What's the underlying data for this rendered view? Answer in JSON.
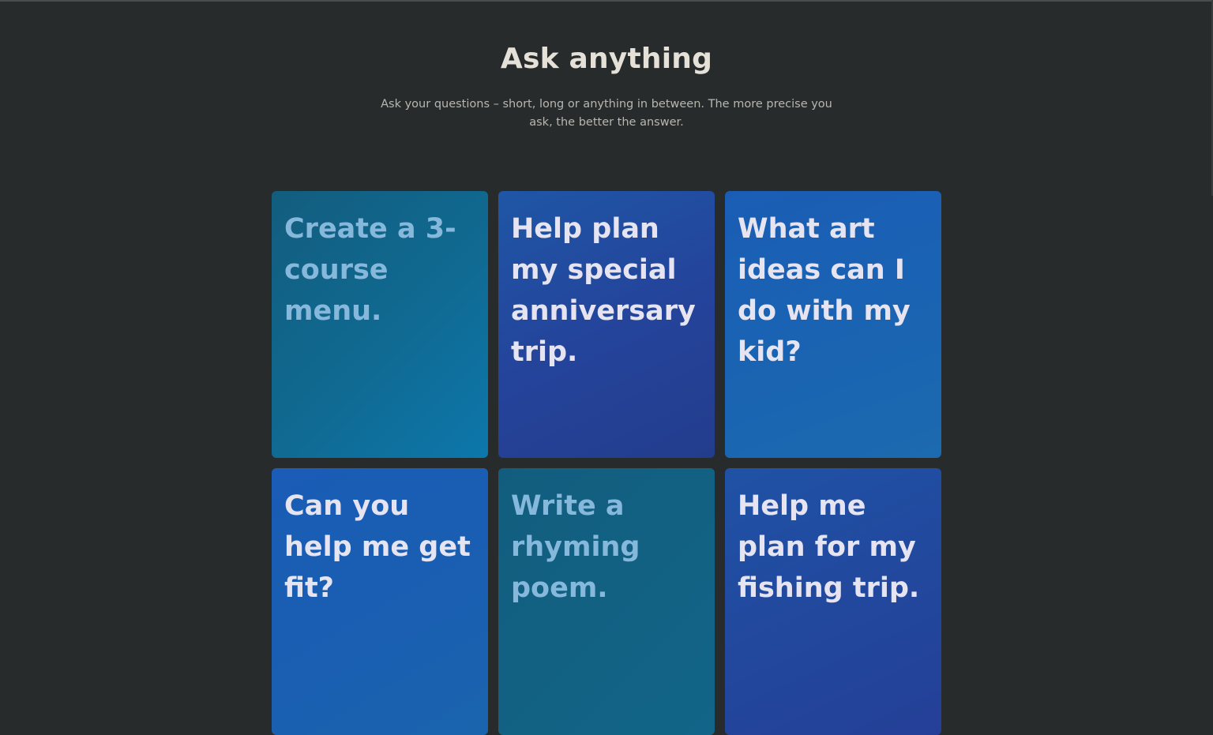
{
  "header": {
    "title": "Ask anything",
    "subtitle": "Ask your questions – short, long or anything in between. The more precise you ask, the better the answer."
  },
  "cards": [
    {
      "label": "Create a 3-course menu."
    },
    {
      "label": "Help plan my special anniversary trip."
    },
    {
      "label": "What art ideas can I do with my kid?"
    },
    {
      "label": "Can you help me get fit?"
    },
    {
      "label": "Write a rhyming poem."
    },
    {
      "label": "Help me plan for my fishing trip."
    }
  ],
  "colors": {
    "background": "#282b2b",
    "title": "#e6e1d8",
    "subtitle": "#b7b7b2",
    "card_teal": "#106a92",
    "card_deep_blue": "#24439a",
    "card_blue": "#1a64b2",
    "text_light_blue": "#86b8dc",
    "text_white": "#e6e4f0"
  }
}
